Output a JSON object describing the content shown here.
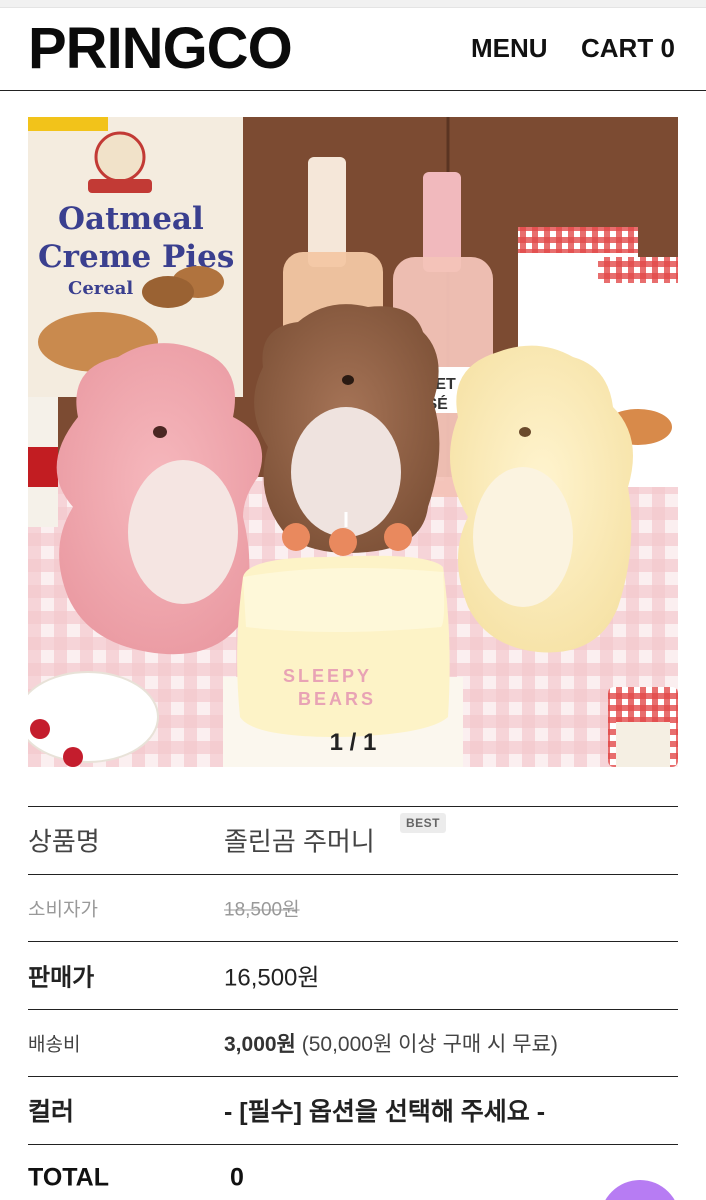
{
  "header": {
    "logo": "PRINGCO",
    "menu_label": "MENU",
    "cart_label": "CART",
    "cart_count": "0"
  },
  "gallery": {
    "counter": "1 / 1"
  },
  "product": {
    "name_label": "상품명",
    "name_value": "졸린곰 주머니",
    "badge": "BEST",
    "consumer_label": "소비자가",
    "consumer_price": "18,500원",
    "sale_label": "판매가",
    "sale_price": "16,500원",
    "shipping_label": "배송비",
    "shipping_fee": "3,000원",
    "shipping_note": "(50,000원 이상 구매 시 무료)",
    "color_label": "컬러",
    "color_select": "- [필수] 옵션을 선택해 주세요 -",
    "total_label": "TOTAL",
    "total_value": "0"
  },
  "colors": {
    "accent_fab": "#b77cf3",
    "text": "#222222"
  }
}
